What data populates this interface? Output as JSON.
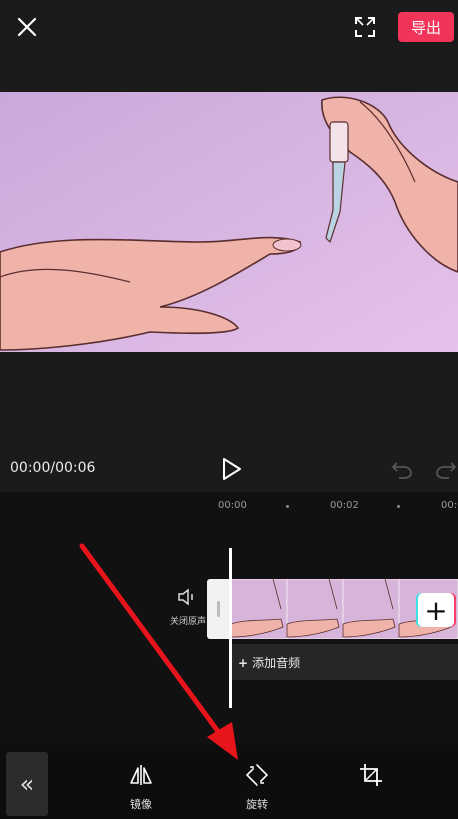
{
  "header": {
    "export_label": "导出"
  },
  "player": {
    "timecode": "00:00/00:06"
  },
  "timeline": {
    "ruler": [
      "00:00",
      "00:02",
      "00:0"
    ],
    "mute_label": "关闭原声",
    "add_audio_label": "添加音频"
  },
  "toolbar": {
    "collapse_glyph": "«",
    "items": [
      {
        "label": "镜像",
        "icon": "mirror-icon"
      },
      {
        "label": "旋转",
        "icon": "rotate-icon"
      },
      {
        "label": "",
        "icon": "crop-icon"
      }
    ]
  },
  "colors": {
    "export_button": "#f0345a",
    "annotation_arrow": "#e8141c",
    "background": "#1b1b1b"
  }
}
